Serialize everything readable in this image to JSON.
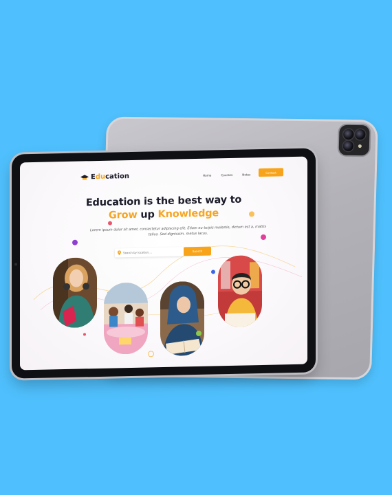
{
  "brand": {
    "logo_first": "E",
    "logo_accent": "du",
    "logo_rest": "cation"
  },
  "nav": {
    "links": [
      "Home",
      "Courses",
      "Notes"
    ],
    "contact_label": "Contact"
  },
  "hero": {
    "line1": "Education is the best way to",
    "line2_a": "Grow",
    "line2_b": " up ",
    "line2_c": "Knowledge",
    "description": "Lorem ipsum dolor sit amet, consectetur adipiscing elit. Etiam eu turpis molestie, dictum est a, mattis tellus. Sed dignissim, metus  lacus."
  },
  "search": {
    "placeholder": "Search by location....",
    "button_label": "Search"
  },
  "colors": {
    "background": "#4fc0fd",
    "accent": "#f5a623",
    "dark_text": "#1c1c2a"
  },
  "photos": [
    "girl-with-book",
    "children-in-classroom",
    "girl-reading-hijab",
    "boy-with-glasses"
  ]
}
